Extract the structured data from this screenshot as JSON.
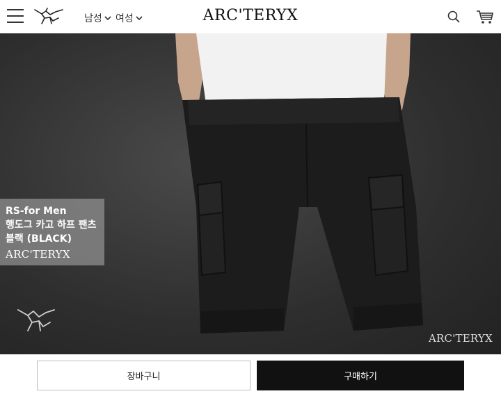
{
  "header": {
    "brand": "ARC'TERYX",
    "nav": [
      {
        "label": "남성"
      },
      {
        "label": "여성"
      }
    ]
  },
  "hero": {
    "product_lines": [
      "RS-for Men",
      "행도그 카고 하프 팬츠",
      "블랙 (BLACK)"
    ],
    "overlay_brand": "ARC'TERYX",
    "watermark_brand": "ARC'TERYX"
  },
  "actions": {
    "cart_label": "장바구니",
    "buy_label": "구매하기"
  },
  "colors": {
    "accent": "#111111",
    "background_dark": "#2e2e2e"
  },
  "icons": [
    "menu-icon",
    "bird-logo-icon",
    "chevron-down-icon",
    "search-icon",
    "cart-icon"
  ]
}
